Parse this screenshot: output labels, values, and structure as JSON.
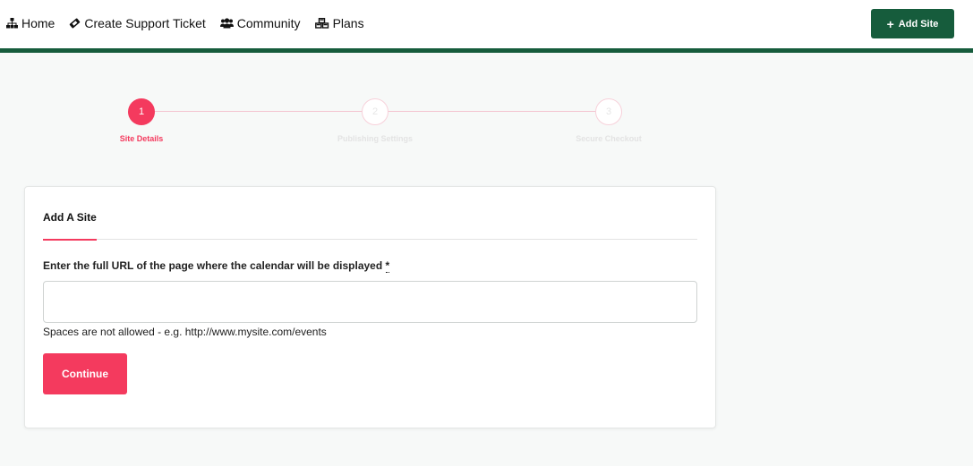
{
  "nav": {
    "items": [
      {
        "label": "Home",
        "icon": "sitemap-icon"
      },
      {
        "label": "Create Support Ticket",
        "icon": "ticket-icon"
      },
      {
        "label": "Community",
        "icon": "users-icon"
      },
      {
        "label": "Plans",
        "icon": "cubes-icon"
      }
    ],
    "add_site_label": "Add Site",
    "add_site_icon": "plus-icon"
  },
  "stepper": {
    "steps": [
      {
        "number": "1",
        "label": "Site Details",
        "state": "active"
      },
      {
        "number": "2",
        "label": "Publishing Settings",
        "state": "inactive"
      },
      {
        "number": "3",
        "label": "Secure Checkout",
        "state": "inactive"
      }
    ]
  },
  "form": {
    "title": "Add A Site",
    "url_label": "Enter the full URL of the page where the calendar will be displayed",
    "required_mark": "*",
    "url_value": "",
    "url_placeholder": "",
    "help_text": "Spaces are not allowed - e.g. http://www.mysite.com/events",
    "continue_label": "Continue"
  },
  "colors": {
    "brand_green": "#165c3c",
    "accent_pink": "#f43a5e",
    "background": "#f7f9f8"
  }
}
